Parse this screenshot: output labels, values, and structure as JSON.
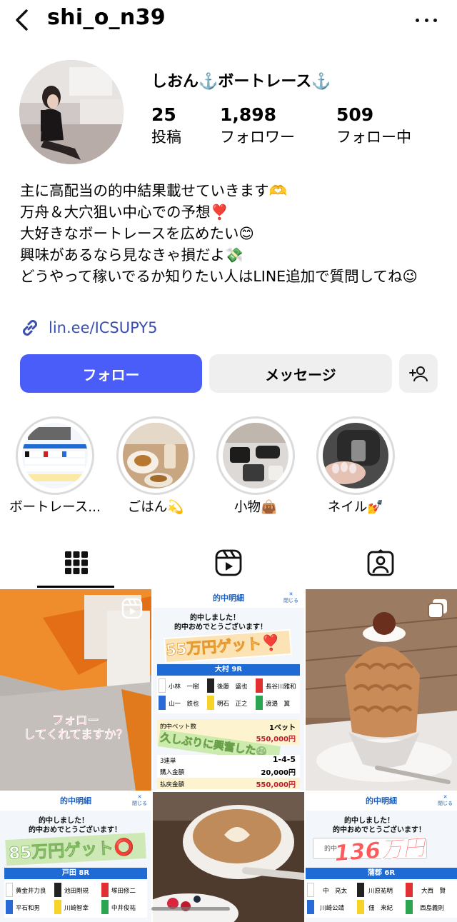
{
  "header": {
    "username": "shi_o_n39",
    "back_icon": "chevron-left-icon",
    "more_icon": "more-horizontal-icon"
  },
  "profile": {
    "display_name": "しおん⚓️ボートレース⚓️",
    "stats": [
      {
        "value": "25",
        "label": "投稿"
      },
      {
        "value": "1,898",
        "label": "フォロワー"
      },
      {
        "value": "509",
        "label": "フォロー中"
      }
    ],
    "bio": [
      "主に高配当の的中結果載せていきます🫶",
      "万舟＆大穴狙い中心での予想❣️",
      "大好きなボートレースを広めたい😊",
      "興味があるなら見なきゃ損だよ💸",
      "どうやって稼いでるか知りたい人はLINE追加で質問してね😉"
    ],
    "link": "lin.ee/ICSUPY5"
  },
  "actions": {
    "follow": "フォロー",
    "message": "メッセージ",
    "add_user_icon": "add-person-icon"
  },
  "highlights": [
    {
      "label": "ボートレース..."
    },
    {
      "label": "ごはん💫"
    },
    {
      "label": "小物👜"
    },
    {
      "label": "ネイル💅"
    }
  ],
  "tabs": [
    "grid-icon",
    "reels-icon",
    "tagged-icon"
  ],
  "posts": {
    "p1_caption_1": "フォロー",
    "p1_caption_2": "してくれてますか？",
    "result_header": "的中明細",
    "close": "閉じる",
    "hit_1": "的中しました！",
    "hit_2": "的中おめでとうございます！",
    "p2_sticker": "55万円ゲット❣️",
    "p2_venue": "大村 9R",
    "p2_racers": [
      "小林　一樹",
      "後藤　盛也",
      "長谷川雅和",
      "山一　鉄也",
      "明石　正之",
      "渡邉　翼"
    ],
    "p2_bet_label": "的中ベット数",
    "p2_bet_value": "1ベット",
    "p2_payout_top": "550,000円",
    "p2_sticker2": "久しぶりに興奮した😆",
    "p2_type": "3連単",
    "p2_combo": "1-4-5",
    "p2_buy_label": "購入金額",
    "p2_buy_value": "20,000円",
    "p2_refund_label": "払戻金額",
    "p2_refund_value": "550,000円",
    "p4_sticker": "85万円ゲット⭕️",
    "p4_venue": "戸田 8R",
    "p4_racers": [
      "黄金井力良",
      "池田剛規",
      "塚田修二",
      "平石和男",
      "川崎智幸",
      "中井俊祐"
    ],
    "p6_sticker": "136万円",
    "p6_venue": "蒲郡 6R",
    "p6_racers": [
      "中　亮太",
      "川原祐明",
      "大西　賢",
      "川崎公靖",
      "佃　来紀",
      "西島義則"
    ],
    "p6_partial": "的中"
  }
}
